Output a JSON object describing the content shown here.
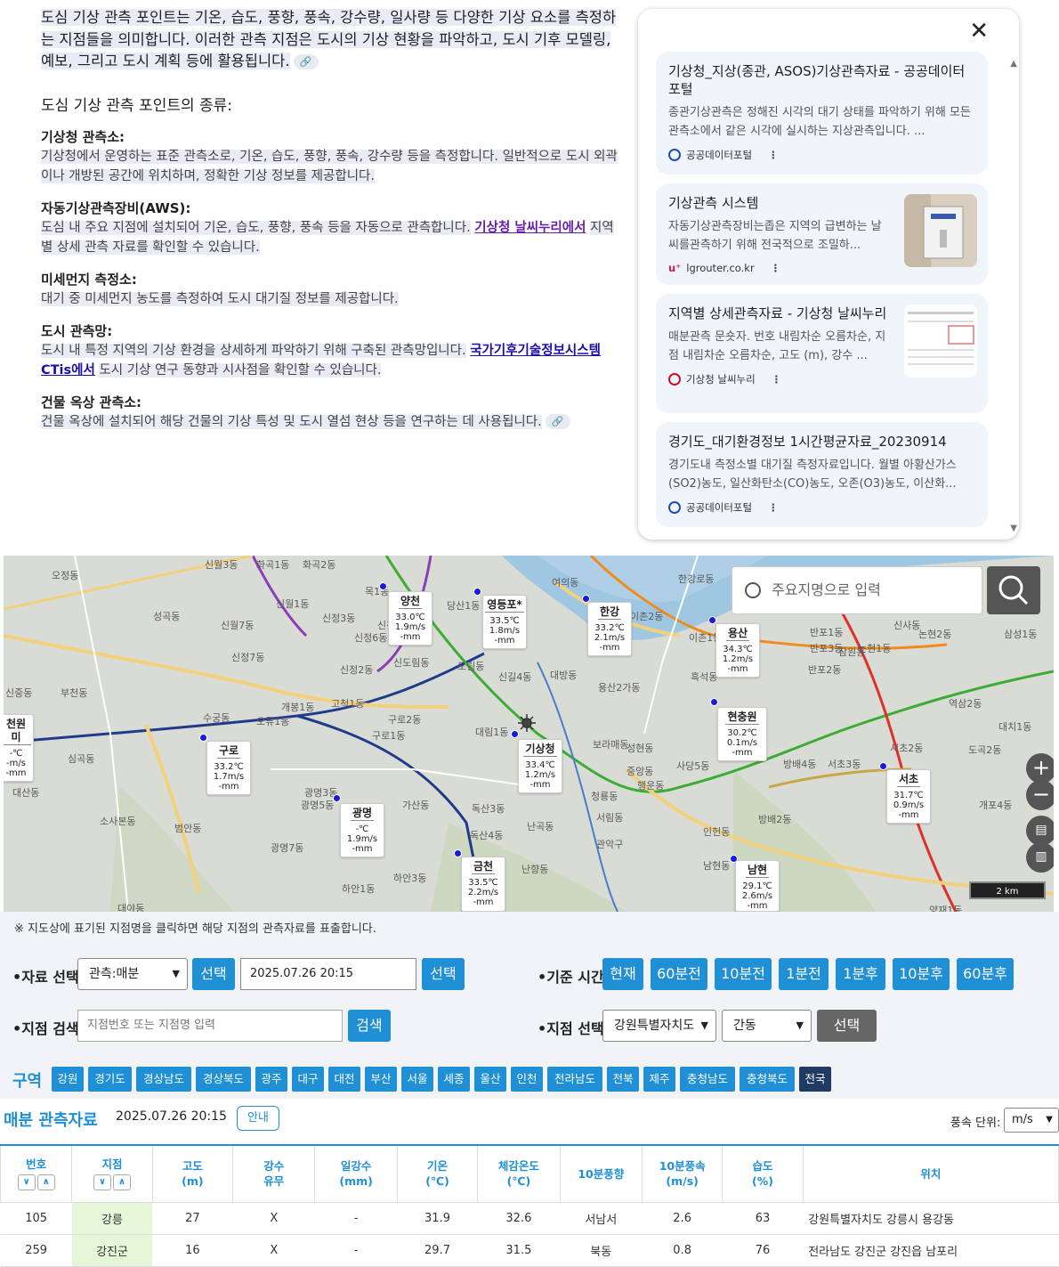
{
  "article": {
    "intro": "도심 기상 관측 포인트는 기온, 습도, 풍향, 풍속, 강수량, 일사량 등 다양한 기상 요소를 측정하는 지점들을 의미합니다. 이러한 관측 지점은 도시의 기상 현황을 파악하고, 도시 기후 모델링, 예보, 그리고 도시 계획 등에 활용됩니다.",
    "subhead": "도심 기상 관측 포인트의 종류:",
    "sections": [
      {
        "term": "기상청 관측소:",
        "desc": "기상청에서 운영하는 표준 관측소로, 기온, 습도, 풍향, 풍속, 강수량 등을 측정합니다. 일반적으로 도시 외곽이나 개방된 공간에 위치하며, 정확한 기상 정보를 제공합니다."
      },
      {
        "term": "자동기상관측장비(AWS):",
        "desc": "도심 내 주요 지점에 설치되어 기온, 습도, 풍향, 풍속 등을 자동으로 관측합니다.",
        "link": "기상청 날씨누리에서",
        "desc2": "지역별 상세 관측 자료를 확인할 수 있습니다."
      },
      {
        "term": "미세먼지 측정소:",
        "desc": "대기 중 미세먼지 농도를 측정하여 도시 대기질 정보를 제공합니다."
      },
      {
        "term": "도시 관측망:",
        "desc": "도시 내 특정 지역의 기상 환경을 상세하게 파악하기 위해 구축된 관측망입니다.",
        "link": "국가기후기술정보시스템 CTis에서",
        "desc2": "도시 기상 연구 동향과 시사점을 확인할 수 있습니다."
      },
      {
        "term": "건물 옥상 관측소:",
        "desc": "건물 옥상에 설치되어 해당 건물의 기상 특성 및 도시 열섬 현상 등을 연구하는 데 사용됩니다."
      }
    ]
  },
  "panel": {
    "cards": [
      {
        "title": "기상청_지상(종관, ASOS)기상관측자료 - 공공데이터포털",
        "snippet": "종관기상관측은 정해진 시각의 대기 상태를 파악하기 위해 모든 관측소에서 같은 시각에 실시하는 지상관측입니다. ...",
        "source": "공공데이터포털"
      },
      {
        "title": "기상관측 시스템",
        "snippet": "자동기상관측장비는좁은 지역의 급변하는 날씨를관측하기 위해 전국적으로 조밀하...",
        "source": "lgrouter.co.kr"
      },
      {
        "title": "지역별 상세관측자료 - 기상청 날씨누리",
        "snippet": "매분관측 문숏자. 번호 내림차순 오름차순, 지점 내림차순 오름차순, 고도 (m), 강수 ...",
        "source": "기상청 날씨누리"
      },
      {
        "title": "경기도_대기환경정보 1시간평균자료_20230914",
        "snippet": "경기도내 측정소별 대기질 측정자료입니다. 월별 아황산가스(SO2)농도, 일산화탄소(CO)농도, 오존(O3)농도, 이산화...",
        "source": "공공데이터포털"
      }
    ]
  },
  "map": {
    "search_placeholder": "주요지명으로 입력",
    "scale": "2 km",
    "places": [
      "신월3동",
      "화곡1동",
      "화곡2동",
      "오정동",
      "성곡동",
      "신월7동",
      "신월1동",
      "신정3동",
      "신정1동",
      "신정6동",
      "신정7동",
      "목1동",
      "당산1동",
      "여의동",
      "한강로동",
      "이촌2동",
      "이촌1동",
      "신정2동",
      "신도림동",
      "도림동",
      "신길4동",
      "대방동",
      "용산2가동",
      "반포3동",
      "논현1동",
      "논현2동",
      "삼성1동",
      "신중동",
      "부천동",
      "개봉1동",
      "고척1동",
      "구로2동",
      "구로1동",
      "대림1동",
      "보라매동",
      "성현동",
      "사당5동",
      "방배4동",
      "서초2동",
      "역삼2동",
      "도곡2동",
      "대치1동",
      "심곡동",
      "대산동",
      "소사본동",
      "범안동",
      "광명3동",
      "광명5동",
      "광명7동",
      "가산동",
      "독산3동",
      "독산4동",
      "난곡동",
      "서림동",
      "관악구",
      "남현동",
      "인헌동",
      "개포4동",
      "양재1동",
      "하안1동",
      "하안3동",
      "대야동",
      "난향동",
      "청룡동",
      "중앙동",
      "행운동",
      "수궁동",
      "오류1동",
      "흑석동",
      "방배2동",
      "서초3동",
      "반포2동",
      "반포1동",
      "잠원동",
      "신사동"
    ],
    "stations": [
      {
        "name": "양천",
        "temp": "33.0℃",
        "wind": "1.9m/s",
        "rain": "-mm"
      },
      {
        "name": "영등포*",
        "temp": "33.5℃",
        "wind": "1.8m/s",
        "rain": "-mm"
      },
      {
        "name": "한강",
        "temp": "33.2℃",
        "wind": "2.1m/s",
        "rain": "-mm"
      },
      {
        "name": "용산",
        "temp": "34.3℃",
        "wind": "1.2m/s",
        "rain": "-mm"
      },
      {
        "name": "현충원",
        "temp": "30.2℃",
        "wind": "0.1m/s",
        "rain": "-mm"
      },
      {
        "name": "구로",
        "temp": "33.2℃",
        "wind": "1.7m/s",
        "rain": "-mm"
      },
      {
        "name": "기상청",
        "temp": "33.4℃",
        "wind": "1.2m/s",
        "rain": "-mm"
      },
      {
        "name": "광명",
        "temp": "-℃",
        "wind": "1.9m/s",
        "rain": "-mm"
      },
      {
        "name": "서초",
        "temp": "31.7℃",
        "wind": "0.9m/s",
        "rain": "-mm"
      },
      {
        "name": "금천",
        "temp": "33.5℃",
        "wind": "2.2m/s",
        "rain": "-mm"
      },
      {
        "name": "남현",
        "temp": "29.1℃",
        "wind": "2.6m/s",
        "rain": "-mm"
      },
      {
        "name": "천원미",
        "temp": "-℃",
        "wind": "-m/s",
        "rain": "-mm"
      }
    ]
  },
  "controls": {
    "note": "※ 지도상에 표기된 지점명을 클릭하면 해당 지점의 관측자료를 표출합니다.",
    "data_select_label": "•자료 선택",
    "data_select_value": "관측:매분",
    "select_btn": "선택",
    "datetime_value": "2025.07.26 20:15",
    "datetime_select_btn": "선택",
    "base_time_label": "•기준 시간",
    "time_buttons": [
      "현재",
      "60분전",
      "10분전",
      "1분전",
      "1분후",
      "10분후",
      "60분후"
    ],
    "station_search_label": "•지점 검색",
    "station_search_placeholder": "지점번호 또는 지점명 입력",
    "search_btn": "검색",
    "station_select_label": "•지점 선택",
    "province_value": "강원특별자치도",
    "city_value": "간동",
    "station_select_btn": "선택",
    "region_label": "구역",
    "regions": [
      "강원",
      "경기도",
      "경상남도",
      "경상북도",
      "광주",
      "대구",
      "대전",
      "부산",
      "서울",
      "세종",
      "울산",
      "인천",
      "전라남도",
      "전북",
      "제주",
      "충청남도",
      "충청북도",
      "전국"
    ]
  },
  "table": {
    "title": "매분 관측자료",
    "time": "2025.07.26 20:15",
    "guide_btn": "안내",
    "wind_unit_label": "풍속 단위:",
    "wind_unit_value": "m/s",
    "headers": [
      "번호",
      "지점",
      "고도\n(m)",
      "강수\n유무",
      "일강수\n(mm)",
      "기온\n(℃)",
      "체감온도\n(℃)",
      "10분풍향",
      "10분풍속\n(m/s)",
      "습도\n(%)",
      "위치"
    ],
    "rows": [
      [
        "105",
        "강릉",
        "27",
        "X",
        "-",
        "31.9",
        "32.6",
        "서남서",
        "2.6",
        "63",
        "강원특별자치도 강릉시 용강동"
      ],
      [
        "259",
        "강진군",
        "16",
        "X",
        "-",
        "29.7",
        "31.5",
        "북동",
        "0.8",
        "76",
        "전라남도 강진군 강진읍 남포리"
      ]
    ]
  }
}
